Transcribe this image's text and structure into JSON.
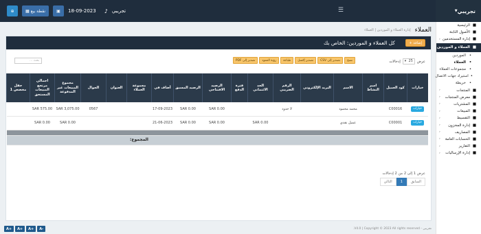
{
  "topbar": {
    "brand": "تجريبي",
    "user": "تجريبي",
    "date": "18-09-2023",
    "pos_label": "نقطة بيع"
  },
  "sidebar": {
    "items": [
      {
        "label": "الرئيسية",
        "icon": "home-icon"
      },
      {
        "label": "الأصول الثابتة",
        "icon": "box-icon"
      },
      {
        "label": "إدارة المستخدمين",
        "icon": "users-icon"
      },
      {
        "label": "العملاء و الموردين",
        "icon": "user-icon",
        "active": true
      },
      {
        "label": "الموردين",
        "sub": true
      },
      {
        "label": "العملاء",
        "sub": true,
        "current": true
      },
      {
        "label": "مجموعات العملاء",
        "sub": true
      },
      {
        "label": "استيراد جهات الاتصال",
        "sub": true
      },
      {
        "label": "خريطة",
        "sub": true
      },
      {
        "label": "المنتجات",
        "icon": "cube-icon"
      },
      {
        "label": "معرض المنتجات",
        "icon": "gallery-icon"
      },
      {
        "label": "المشتريات",
        "icon": "cart-icon"
      },
      {
        "label": "المبيعات",
        "icon": "tag-icon"
      },
      {
        "label": "التقسيط",
        "icon": "calendar-icon"
      },
      {
        "label": "إدارة المخزون",
        "icon": "warehouse-icon"
      },
      {
        "label": "المصاريف",
        "icon": "money-icon"
      },
      {
        "label": "الحسابات العامة",
        "icon": "chart-icon"
      },
      {
        "label": "التقارير",
        "icon": "report-icon"
      },
      {
        "label": "إدارة الإرساليات",
        "icon": "truck-icon"
      }
    ]
  },
  "page": {
    "title": "العملاء",
    "breadcrumb": "إدارة العملاء و الموردين | العملاء",
    "card_title": "كل العملاء و الموردين: الخاص بك",
    "add_label": "إضافة +"
  },
  "controls": {
    "show_label": "عرض",
    "entries_label": "إدخالات",
    "page_size": "25",
    "search_placeholder": "بحث ...",
    "export": [
      "نسخ",
      "تصدير إلى CSV",
      "تصدير إكسل",
      "طباعة",
      "رؤية العمود",
      "تصدير إلى PDF"
    ]
  },
  "table": {
    "columns": [
      "خيارات",
      "كود العميل",
      "اسم النشاط",
      "الاسم",
      "البريد الإلكتروني",
      "الرقم الضريبي",
      "الحد الائتماني",
      "فترة الدفع",
      "الرصيد الافتتاحي",
      "الرصيد المسبق",
      "أضاف في",
      "مجموعة العملاء",
      "العنوان",
      "الجوال",
      "مجموع المبيعات غير المدفوعة",
      "اجمالي مرتجع المبيعات المستحق",
      "حقل مخصص 1"
    ],
    "rows": [
      {
        "action": "خيارات",
        "code": "C00016",
        "business": "",
        "name": "محمد محمود",
        "email": "",
        "tax": "لا حدود",
        "credit": "",
        "pay_term": "",
        "opening": "SAR 0.00",
        "advance": "SAR 0.00",
        "added": "17-09-2023",
        "group": "",
        "address": "",
        "mobile": "0567",
        "due": "SAR 3,075.00",
        "return_due": "SAR 575.00",
        "custom": ""
      },
      {
        "action": "خيارات",
        "code": "C00001",
        "business": "",
        "name": "عميل نقدي",
        "email": "",
        "tax": "",
        "credit": "SAR 0.00",
        "pay_term": "",
        "opening": "SAR 0.00",
        "advance": "SAR 0.00",
        "added": "21-06-2023",
        "group": "",
        "address": "",
        "mobile": "",
        "due": "SAR 0.00",
        "return_due": "SAR 0.00",
        "custom": ""
      }
    ],
    "total_label": "المجموع:"
  },
  "pagination": {
    "info": "عرض 1 إلى 2 من 2 إدخالات",
    "prev": "السابق",
    "page": "1",
    "next": "التالي"
  },
  "footer": {
    "text": "تجريبي - V4.0 | Copyright © 2023 All rights reserved."
  },
  "zoom": [
    "A+",
    "A+",
    "A+",
    "A-"
  ]
}
